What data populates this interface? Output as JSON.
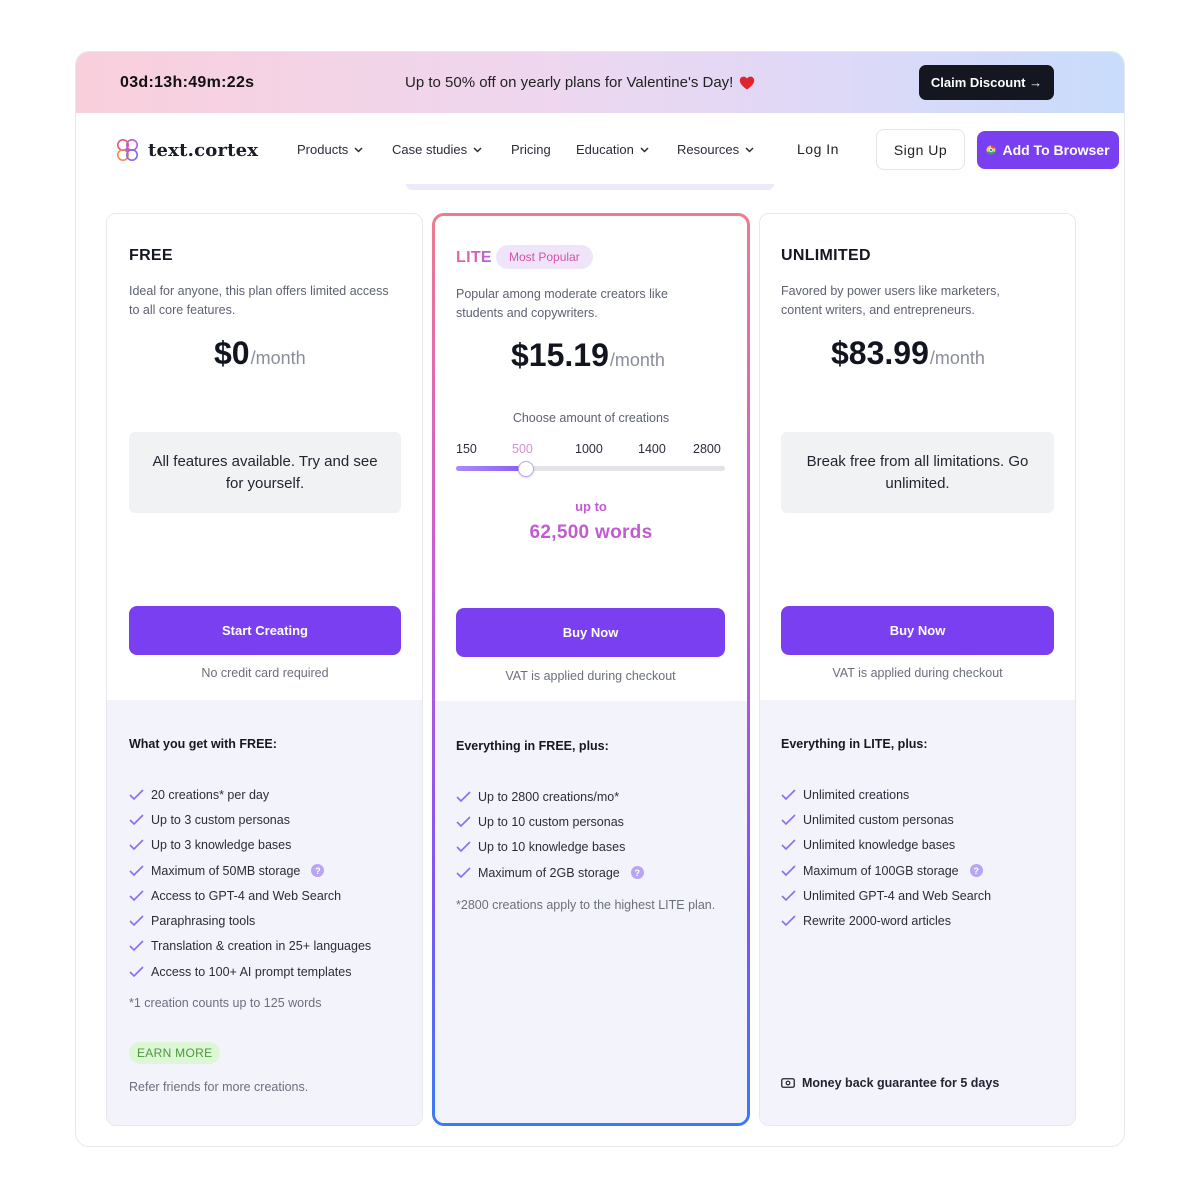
{
  "banner": {
    "countdown": "03d:13h:49m:22s",
    "promo_text": "Up to 50% off on yearly plans for Valentine's Day!",
    "claim_label": "Claim Discount →"
  },
  "nav": {
    "logo_text": "text.cortex",
    "items": [
      "Products",
      "Case studies",
      "Pricing",
      "Education",
      "Resources"
    ],
    "login": "Log In",
    "signup": "Sign Up",
    "add_browser": "Add To Browser"
  },
  "plans": {
    "free": {
      "name": "FREE",
      "description": "Ideal for anyone, this plan offers limited access to all core features.",
      "price": "$0",
      "period": "/month",
      "box_text": "All features available. Try and see for yourself.",
      "cta": "Start Creating",
      "cta_note": "No credit card required",
      "features_title": "What you get with FREE:",
      "features": [
        "20 creations* per day",
        "Up to 3 custom personas",
        "Up to 3 knowledge bases",
        "Maximum of 50MB storage",
        "Access to GPT-4 and Web Search",
        "Paraphrasing tools",
        "Translation & creation in 25+ languages",
        "Access to 100+ AI prompt templates"
      ],
      "footnote": "*1 creation counts up to 125 words",
      "earn_label": "EARN MORE",
      "refer_text": "Refer friends for more creations."
    },
    "lite": {
      "name": "LITE",
      "badge": "Most Popular",
      "description": "Popular among moderate creators like students and copywriters.",
      "price": "$15.19",
      "period": "/month",
      "slider_label": "Choose amount of creations",
      "ticks": [
        "150",
        "500",
        "1000",
        "1400",
        "2800"
      ],
      "selected_tick": "500",
      "slider_fraction": 0.26,
      "upto_label": "up to",
      "words": "62,500 words",
      "cta": "Buy Now",
      "cta_note": "VAT is applied during checkout",
      "features_title": "Everything in FREE, plus:",
      "features": [
        "Up to 2800 creations/mo*",
        "Up to 10 custom personas",
        "Up to 10 knowledge bases",
        "Maximum of 2GB storage"
      ],
      "footnote": "*2800 creations apply to the highest LITE plan."
    },
    "unlimited": {
      "name": "UNLIMITED",
      "description": "Favored by power users like marketers, content writers, and entrepreneurs.",
      "price": "$83.99",
      "period": "/month",
      "box_text": "Break free from all limitations. Go unlimited.",
      "cta": "Buy Now",
      "cta_note": "VAT is applied during checkout",
      "features_title": "Everything in LITE, plus:",
      "features": [
        "Unlimited creations",
        "Unlimited custom personas",
        "Unlimited knowledge bases",
        "Maximum of 100GB storage",
        "Unlimited GPT-4 and Web Search",
        "Rewrite 2000-word articles"
      ],
      "guarantee": "Money back guarantee for 5 days"
    }
  },
  "colors": {
    "accent": "#7b3ff2",
    "lite_gradient": [
      "#f07a8e",
      "#c75bd6",
      "#7b55f5",
      "#3b7af7"
    ],
    "words_color": "#c25bd0",
    "earn_bg": "#dcf6d6"
  }
}
